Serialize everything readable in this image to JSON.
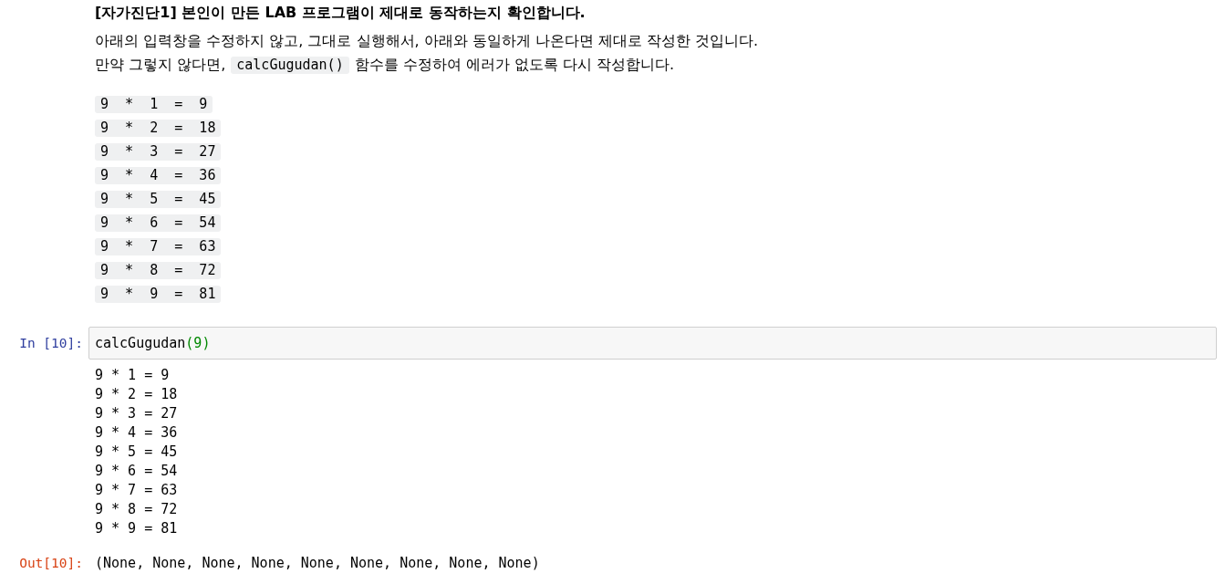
{
  "markdown_cell": {
    "heading": "[자가진단1] 본인이 만든 LAB 프로그램이 제대로 동작하는지 확인합니다.",
    "paragraphs": [
      [
        {
          "kind": "text",
          "text": "아래의 입력창을 수정하지 않고, 그대로 실행해서, 아래와 동일하게 나온다면 제대로 작성한 것입니다."
        }
      ],
      [
        {
          "kind": "text",
          "text": "만약 그렇지 않다면,"
        },
        {
          "kind": "code",
          "text": "calcGugudan()"
        },
        {
          "kind": "text",
          "text": "함수를 수정하여 에러가 없도록 다시 작성합니다."
        }
      ]
    ],
    "code_lines": [
      "9  *  1  =  9",
      "9  *  2  =  18",
      "9  *  3  =  27",
      "9  *  4  =  36",
      "9  *  5  =  45",
      "9  *  6  =  54",
      "9  *  7  =  63",
      "9  *  8  =  72",
      "9  *  9  =  81"
    ]
  },
  "code_cell": {
    "prompt": "In [10]:",
    "source": [
      {
        "kind": "name",
        "text": "calcGugudan"
      },
      {
        "kind": "number",
        "text": "(9)"
      }
    ],
    "stdout": [
      "9 * 1 = 9",
      "9 * 2 = 18",
      "9 * 3 = 27",
      "9 * 4 = 36",
      "9 * 5 = 45",
      "9 * 6 = 54",
      "9 * 7 = 63",
      "9 * 8 = 72",
      "9 * 9 = 81"
    ],
    "out_prompt": "Out[10]:",
    "result": "(None, None, None, None, None, None, None, None, None)"
  }
}
